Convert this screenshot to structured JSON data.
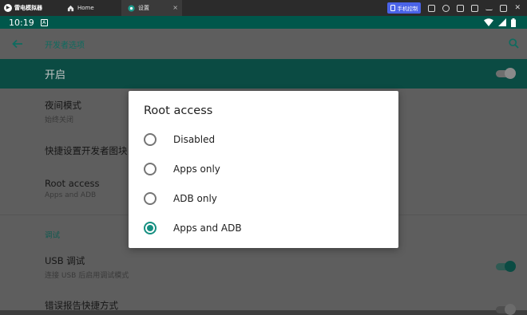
{
  "emulator": {
    "brand": "雷电模拟器",
    "tabs": [
      {
        "label": "Home"
      },
      {
        "label": "设置"
      }
    ],
    "phone_control_label": "手机控制"
  },
  "status_bar": {
    "time": "10:19"
  },
  "app_bar": {
    "title": "开发者选项"
  },
  "master_switch": {
    "label": "开启",
    "checked": true
  },
  "preferences": [
    {
      "title": "夜间模式",
      "summary": "始终关闭"
    },
    {
      "title": "快捷设置开发者图块",
      "summary": ""
    },
    {
      "title": "Root access",
      "summary": "Apps and ADB"
    }
  ],
  "debug_section": {
    "header": "调试",
    "items": [
      {
        "title": "USB 调试",
        "summary": "连接 USB 后启用调试模式",
        "checked": true
      },
      {
        "title": "错误报告快捷方式",
        "summary": "",
        "checked": false
      }
    ]
  },
  "dialog": {
    "title": "Root access",
    "options": [
      {
        "label": "Disabled",
        "selected": false
      },
      {
        "label": "Apps only",
        "selected": false
      },
      {
        "label": "ADB only",
        "selected": false
      },
      {
        "label": "Apps and ADB",
        "selected": true
      }
    ]
  },
  "colors": {
    "accent": "#168f81",
    "status_bar": "#00574b",
    "scrim_bg": "#5e5e5e",
    "phone_control": "#4a63e8"
  }
}
